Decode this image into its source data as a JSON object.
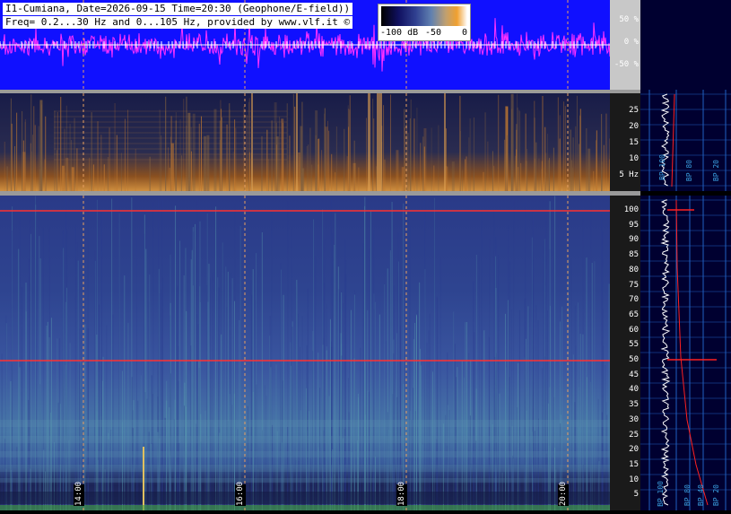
{
  "header": {
    "line1": "I1-Cumiana, Date=2026-09-15 Time=20:30 (Geophone/E-field))",
    "line2": "Freq= 0.2...30 Hz and 0...105 Hz, provided by www.vlf.it ©"
  },
  "colorbar": {
    "labels": [
      "-100 dB",
      "-50",
      "0"
    ]
  },
  "wave_scale": {
    "labels": [
      "50 %",
      "0 %",
      "-50 %"
    ]
  },
  "scale_top": {
    "ticks": [
      "25",
      "20",
      "15",
      "10",
      "5 Hz"
    ]
  },
  "scale_bottom": {
    "ticks": [
      "100",
      "95",
      "90",
      "85",
      "80",
      "75",
      "70",
      "65",
      "60",
      "55",
      "50",
      "45",
      "40",
      "35",
      "30",
      "25",
      "20",
      "15",
      "10",
      "5"
    ]
  },
  "time_labels": [
    "14:00",
    "16:00",
    "18:00",
    "20:00"
  ],
  "right_panel": {
    "bp_labels": [
      "BP 100",
      "BP 80",
      "BP 40",
      "BP 20"
    ]
  },
  "colors": {
    "wave_bg": "#1010ff",
    "wave_line": "#ff30ff",
    "hum_line": "#ff3030",
    "grid": "#e8a060",
    "profile_line": "#ffffff",
    "fit_line": "#ff2020"
  }
}
